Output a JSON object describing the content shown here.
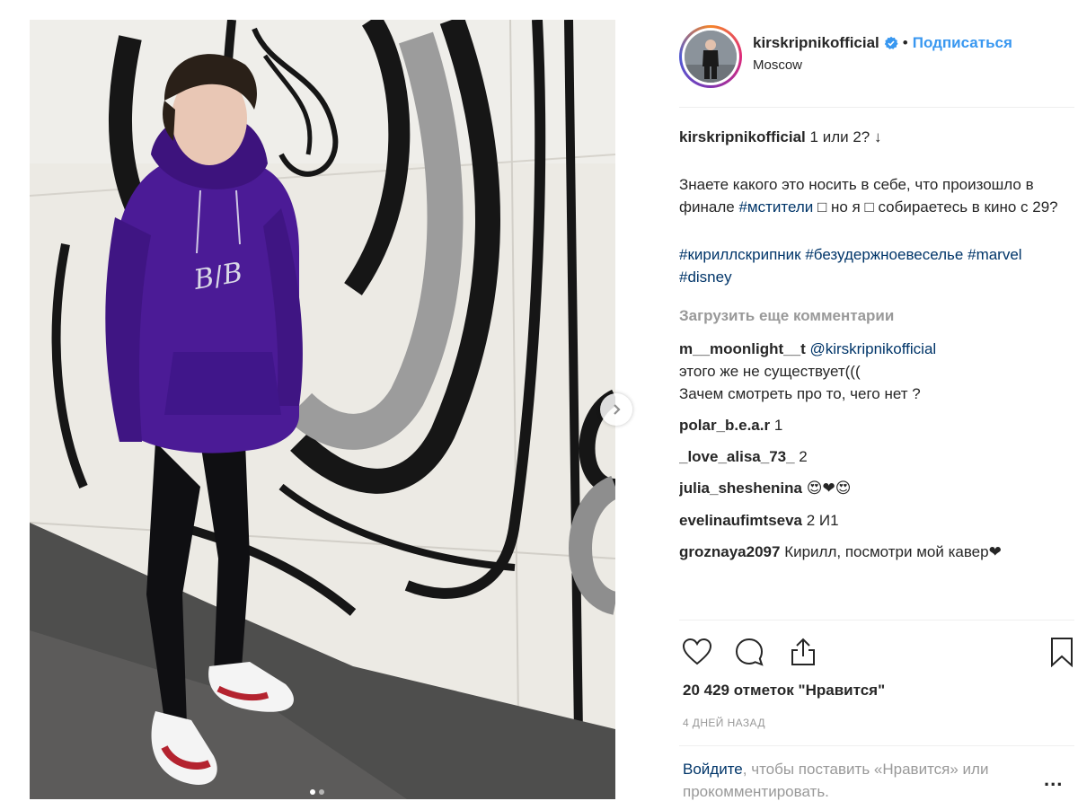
{
  "post": {
    "username": "kirskripnikofficial",
    "verified": true,
    "follow_label": "Подписаться",
    "separator": "•",
    "location": "Moscow",
    "caption": {
      "username": "kirskripnikofficial",
      "first_line": "1 или 2? ↓",
      "paragraph_before_tag": "Знаете какого это носить в себе, что произошло в финале",
      "tag_avengers": "#мстители",
      "paragraph_after_tag": "□ но я □ собираетесь в кино с 29?",
      "hashtags": [
        "#кириллскрипник",
        "#безудержноевеселье",
        "#marvel",
        "#disney"
      ]
    },
    "load_more_label": "Загрузить еще комментарии",
    "comments": [
      {
        "user": "m__moonlight__t",
        "mention": "@kirskripnikofficial",
        "text": "этого же не существует(((\nЗачем смотреть про то, чего нет ?"
      },
      {
        "user": "polar_b.e.a.r",
        "text": "1"
      },
      {
        "user": "_love_alisa_73_",
        "text": "2"
      },
      {
        "user": "julia_sheshenina",
        "text": "😍❤😍"
      },
      {
        "user": "evelinaufimtseva",
        "text": "2 И1"
      },
      {
        "user": "groznaya2097",
        "text": "Кирилл, посмотри мой кавер❤"
      }
    ],
    "likes_label": "20 429 отметок \"Нравится\"",
    "date_label": "4 ДНЕЙ НАЗАД",
    "login_link": "Войдите",
    "login_text": ", чтобы поставить «Нравится» или прокомментировать.",
    "more_label": "...",
    "carousel": {
      "total": 2,
      "current": 1
    }
  },
  "icons": {
    "verified": "verified-badge-icon",
    "like": "heart-outline-icon",
    "comment": "comment-bubble-icon",
    "share": "share-upload-icon",
    "save": "bookmark-icon",
    "next": "chevron-right-icon"
  },
  "colors": {
    "link_blue": "#3897f0",
    "hashtag_blue": "#003569",
    "muted_gray": "#999999",
    "hoodie_purple": "#4b1b96"
  }
}
